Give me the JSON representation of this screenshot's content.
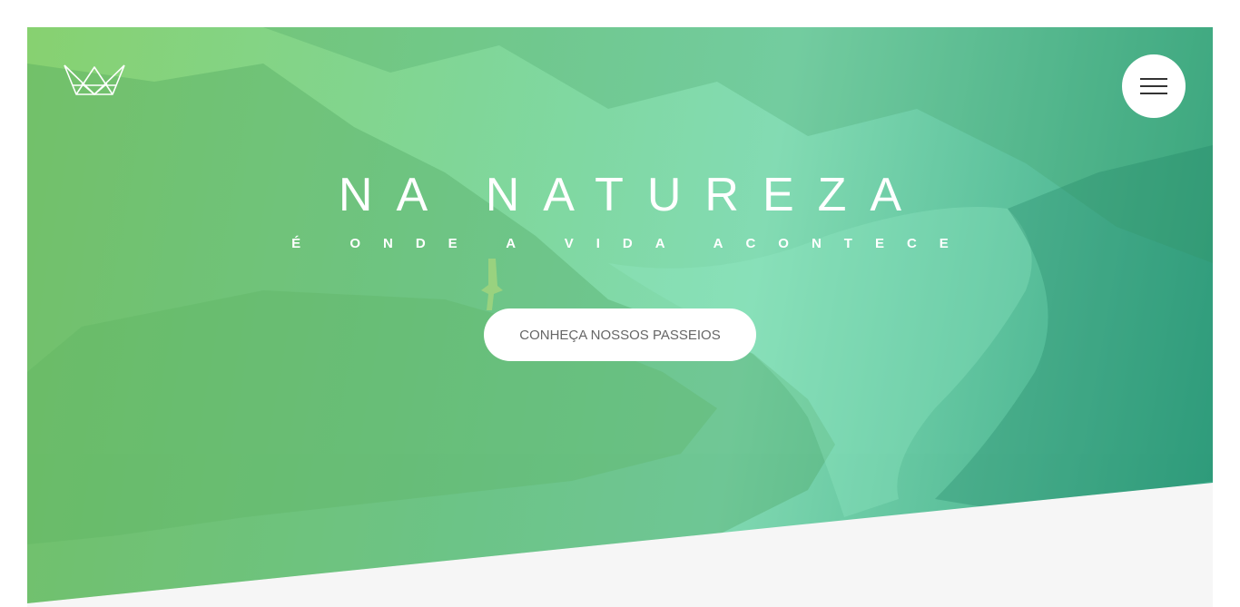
{
  "header": {
    "logo_icon": "crown-logo-icon",
    "menu_icon": "hamburger-menu-icon"
  },
  "hero": {
    "title": "NA NATUREZA",
    "subtitle": "É ONDE A VIDA ACONTECE",
    "cta_label": "CONHEÇA NOSSOS PASSEIOS"
  },
  "colors": {
    "gradient_start": "#7dcd64",
    "gradient_end": "#28a07d",
    "section_background": "#f6f6f6",
    "button_background": "#ffffff",
    "button_text": "#666666"
  }
}
